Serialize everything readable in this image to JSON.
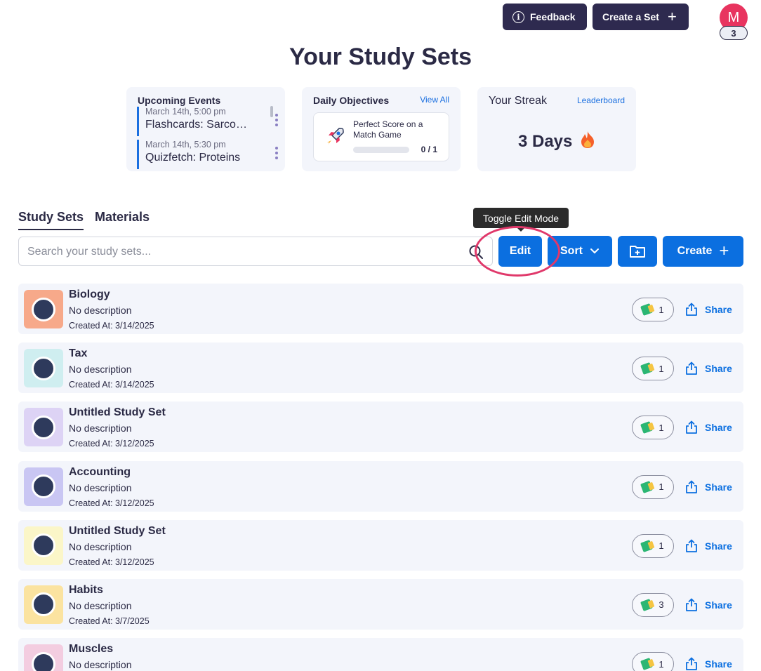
{
  "header": {
    "feedback_label": "Feedback",
    "create_set_label": "Create a Set",
    "avatar_initial": "M",
    "avatar_badge": "3"
  },
  "page_title": "Your Study Sets",
  "upcoming": {
    "title": "Upcoming Events",
    "events": [
      {
        "time": "March 14th, 5:00 pm",
        "title": "Flashcards: Sarcomeres"
      },
      {
        "time": "March 14th, 5:30 pm",
        "title": "Quizfetch: Proteins"
      }
    ]
  },
  "objectives": {
    "title": "Daily Objectives",
    "view_all": "View All",
    "item_text": "Perfect Score on a Match Game",
    "progress_label": "0 / 1",
    "progress_fraction": 0
  },
  "streak": {
    "title": "Your Streak",
    "leaderboard": "Leaderboard",
    "value": "3 Days"
  },
  "tabs": [
    "Study Sets",
    "Materials"
  ],
  "tooltip": "Toggle Edit Mode",
  "search": {
    "placeholder": "Search your study sets..."
  },
  "toolbar": {
    "edit": "Edit",
    "sort": "Sort",
    "create": "Create"
  },
  "colors": {
    "accent": "#0b6fe0",
    "dark": "#2e2a4f",
    "highlight": "#e0386a"
  },
  "sets": [
    {
      "name": "Biology",
      "description": "No description",
      "created": "Created At: 3/14/2025",
      "count": "1",
      "share": "Share",
      "thumb_bg": "#f7a98a"
    },
    {
      "name": "Tax",
      "description": "No description",
      "created": "Created At: 3/14/2025",
      "count": "1",
      "share": "Share",
      "thumb_bg": "#cfeef0"
    },
    {
      "name": "Untitled Study Set",
      "description": "No description",
      "created": "Created At: 3/12/2025",
      "count": "1",
      "share": "Share",
      "thumb_bg": "#ddd3f5"
    },
    {
      "name": "Accounting",
      "description": "No description",
      "created": "Created At: 3/12/2025",
      "count": "1",
      "share": "Share",
      "thumb_bg": "#c9c6f3"
    },
    {
      "name": "Untitled Study Set",
      "description": "No description",
      "created": "Created At: 3/12/2025",
      "count": "1",
      "share": "Share",
      "thumb_bg": "#fbf6c8"
    },
    {
      "name": "Habits",
      "description": "No description",
      "created": "Created At: 3/7/2025",
      "count": "3",
      "share": "Share",
      "thumb_bg": "#fbe3a0"
    },
    {
      "name": "Muscles",
      "description": "No description",
      "created": "",
      "count": "1",
      "share": "Share",
      "thumb_bg": "#f3cde0"
    }
  ]
}
